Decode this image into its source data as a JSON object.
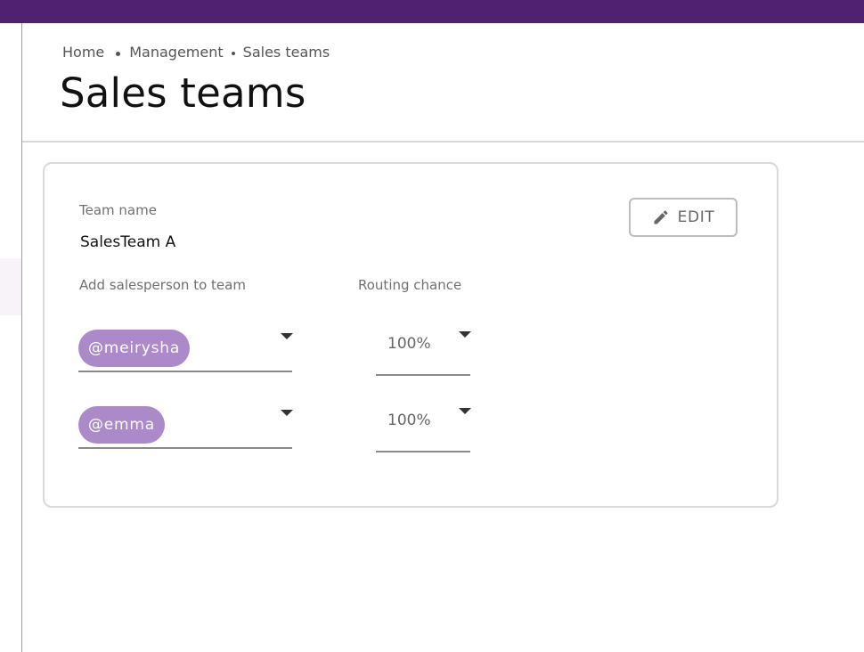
{
  "breadcrumb": {
    "items": [
      "Home",
      "Management",
      "Sales teams"
    ]
  },
  "page": {
    "title": "Sales teams"
  },
  "card": {
    "team_name_label": "Team name",
    "team_name_value": "SalesTeam A",
    "edit_label": "EDIT",
    "add_salesperson_label": "Add salesperson to team",
    "routing_chance_label": "Routing chance",
    "rows": [
      {
        "salesperson": "@meirysha",
        "routing": "100%"
      },
      {
        "salesperson": "@emma",
        "routing": "100%"
      }
    ]
  },
  "colors": {
    "top_bar": "#4f2170",
    "chip": "#ac8ac9"
  },
  "icons": {
    "edit": "pencil-icon",
    "dropdown": "caret-down-icon"
  }
}
